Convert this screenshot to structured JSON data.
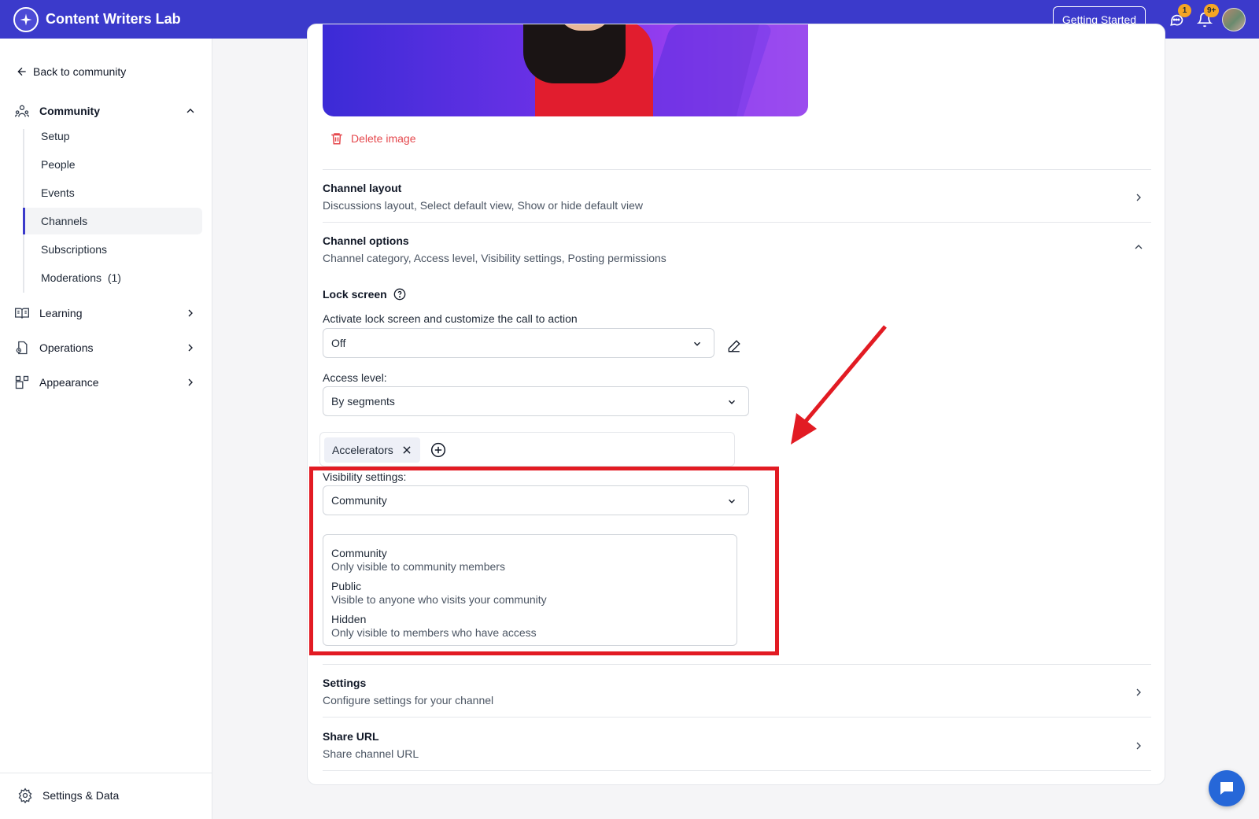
{
  "header": {
    "app_title": "Content Writers Lab",
    "getting_started": "Getting Started",
    "messages_badge": "1",
    "notifications_badge": "9+"
  },
  "sidebar": {
    "back": "Back to community",
    "community": "Community",
    "sub_items": [
      "Setup",
      "People",
      "Events",
      "Channels",
      "Subscriptions",
      "Moderations  (1)"
    ],
    "learning": "Learning",
    "operations": "Operations",
    "appearance": "Appearance",
    "settings_data": "Settings & Data"
  },
  "main": {
    "delete_image": "Delete image",
    "channel_layout": {
      "title": "Channel layout",
      "subtitle": "Discussions layout, Select default view, Show or hide default view"
    },
    "channel_options": {
      "title": "Channel options",
      "subtitle": "Channel category, Access level, Visibility settings, Posting permissions"
    },
    "lock_screen": {
      "title": "Lock screen",
      "description": "Activate lock screen and customize the call to action",
      "value": "Off"
    },
    "access_level": {
      "label": "Access level:",
      "value": "By segments",
      "tags": [
        "Accelerators"
      ]
    },
    "visibility": {
      "label": "Visibility settings:",
      "value": "Community",
      "options": [
        {
          "title": "Community",
          "description": "Only visible to community members"
        },
        {
          "title": "Public",
          "description": "Visible to anyone who visits your community"
        },
        {
          "title": "Hidden",
          "description": "Only visible to members who have access"
        }
      ]
    },
    "settings": {
      "title": "Settings",
      "subtitle": "Configure settings for your channel"
    },
    "share_url": {
      "title": "Share URL",
      "subtitle": "Share channel URL"
    }
  },
  "colors": {
    "brand": "#3b3acb",
    "danger": "#e5484d",
    "annotation": "#e21b23",
    "badge": "#f5a524",
    "chat": "#2667d8"
  }
}
